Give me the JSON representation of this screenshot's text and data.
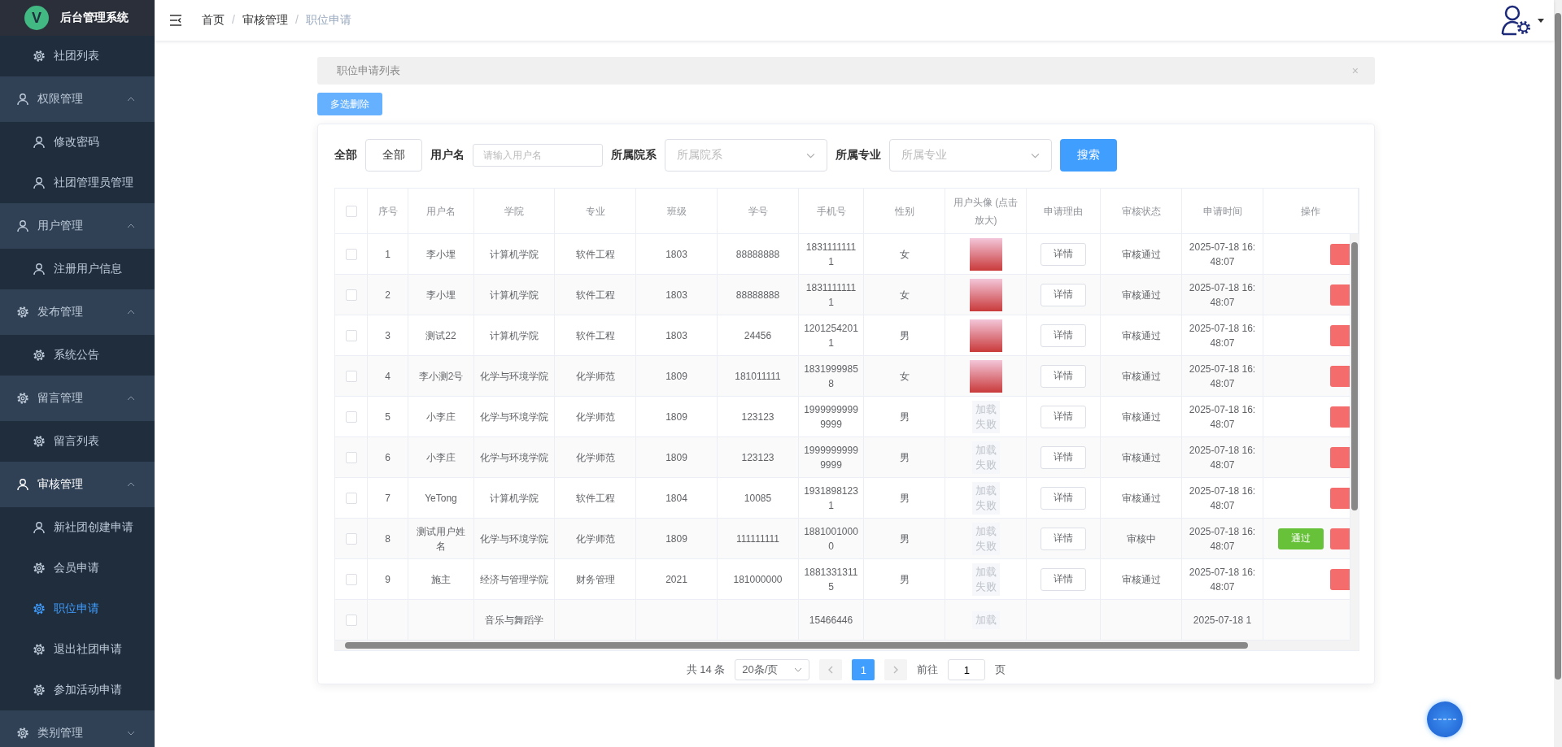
{
  "sidebar": {
    "logo": "V",
    "title": "后台管理系统",
    "items": [
      {
        "kind": "item",
        "label": "社团列表",
        "selected": false
      },
      {
        "kind": "group",
        "label": "权限管理",
        "expanded": true,
        "active": false,
        "children": [
          {
            "label": "修改密码",
            "selected": false
          },
          {
            "label": "社团管理员管理",
            "selected": false
          }
        ]
      },
      {
        "kind": "group",
        "label": "用户管理",
        "expanded": true,
        "active": false,
        "children": [
          {
            "label": "注册用户信息",
            "selected": false
          }
        ]
      },
      {
        "kind": "group",
        "label": "发布管理",
        "expanded": true,
        "active": false,
        "children": [
          {
            "label": "系统公告",
            "selected": false
          }
        ]
      },
      {
        "kind": "group",
        "label": "留言管理",
        "expanded": true,
        "active": false,
        "children": [
          {
            "label": "留言列表",
            "selected": false
          }
        ]
      },
      {
        "kind": "group",
        "label": "审核管理",
        "expanded": true,
        "active": true,
        "children": [
          {
            "label": "新社团创建申请",
            "selected": false
          },
          {
            "label": "会员申请",
            "selected": false
          },
          {
            "label": "职位申请",
            "selected": true
          },
          {
            "label": "退出社团申请",
            "selected": false
          },
          {
            "label": "参加活动申请",
            "selected": false
          }
        ]
      },
      {
        "kind": "group",
        "label": "类别管理",
        "expanded": false,
        "active": false
      }
    ]
  },
  "breadcrumb": {
    "separator": "/",
    "items": [
      "首页",
      "审核管理",
      "职位申请"
    ]
  },
  "tag": {
    "label": "职位申请列表",
    "close": "×"
  },
  "bulk_delete_button": "多选删除",
  "filters": {
    "all_label": "全部",
    "all_button": "全部",
    "username_label": "用户名",
    "username_placeholder": "请输入用户名",
    "college_label": "所属院系",
    "college_placeholder": "所属院系",
    "major_label": "所属专业",
    "major_placeholder": "所属专业",
    "search_button": "搜索"
  },
  "table": {
    "select_all_checked": false,
    "columns": [
      "序号",
      "用户名",
      "学院",
      "专业",
      "班级",
      "学号",
      "手机号",
      "性别",
      "用户头像 (点击放大)",
      "申请理由",
      "审核状态",
      "申请时间",
      "操作"
    ],
    "rows": [
      {
        "checked": false,
        "no": "1",
        "username": "李小埋",
        "college": "计算机学院",
        "major": "软件工程",
        "class": "1803",
        "student_id": "88888888",
        "phone": "18311111111",
        "gender": "女",
        "avatar": {
          "kind": "photo"
        },
        "reason": "详情",
        "status": "审核通过",
        "time": "2025-07-18 16:48:07",
        "actions": [
          {
            "kind": "delete"
          }
        ]
      },
      {
        "checked": false,
        "no": "2",
        "username": "李小埋",
        "college": "计算机学院",
        "major": "软件工程",
        "class": "1803",
        "student_id": "88888888",
        "phone": "18311111111",
        "gender": "女",
        "avatar": {
          "kind": "photo"
        },
        "reason": "详情",
        "status": "审核通过",
        "time": "2025-07-18 16:48:07",
        "actions": [
          {
            "kind": "delete"
          }
        ]
      },
      {
        "checked": false,
        "no": "3",
        "username": "测试22",
        "college": "计算机学院",
        "major": "软件工程",
        "class": "1803",
        "student_id": "24456",
        "phone": "12012542011",
        "gender": "男",
        "avatar": {
          "kind": "photo"
        },
        "reason": "详情",
        "status": "审核通过",
        "time": "2025-07-18 16:48:07",
        "actions": [
          {
            "kind": "delete"
          }
        ]
      },
      {
        "checked": false,
        "no": "4",
        "username": "李小测2号",
        "college": "化学与环境学院",
        "major": "化学师范",
        "class": "1809",
        "student_id": "181011111",
        "phone": "18319999858",
        "gender": "女",
        "avatar": {
          "kind": "photo"
        },
        "reason": "详情",
        "status": "审核通过",
        "time": "2025-07-18 16:48:07",
        "actions": [
          {
            "kind": "delete"
          }
        ]
      },
      {
        "checked": false,
        "no": "5",
        "username": "小李庄",
        "college": "化学与环境学院",
        "major": "化学师范",
        "class": "1809",
        "student_id": "123123",
        "phone": "19999999999999",
        "gender": "男",
        "avatar": {
          "kind": "failed",
          "text": "加载失败"
        },
        "reason": "详情",
        "status": "审核通过",
        "time": "2025-07-18 16:48:07",
        "actions": [
          {
            "kind": "delete"
          }
        ]
      },
      {
        "checked": false,
        "no": "6",
        "username": "小李庄",
        "college": "化学与环境学院",
        "major": "化学师范",
        "class": "1809",
        "student_id": "123123",
        "phone": "19999999999999",
        "gender": "男",
        "avatar": {
          "kind": "failed",
          "text": "加载失败"
        },
        "reason": "详情",
        "status": "审核通过",
        "time": "2025-07-18 16:48:07",
        "actions": [
          {
            "kind": "delete"
          }
        ]
      },
      {
        "checked": false,
        "no": "7",
        "username": "YeTong",
        "college": "计算机学院",
        "major": "软件工程",
        "class": "1804",
        "student_id": "10085",
        "phone": "19318981231",
        "gender": "男",
        "avatar": {
          "kind": "failed",
          "text": "加载失败"
        },
        "reason": "详情",
        "status": "审核通过",
        "time": "2025-07-18 16:48:07",
        "actions": [
          {
            "kind": "delete"
          }
        ]
      },
      {
        "checked": false,
        "no": "8",
        "username": "测试用户姓名",
        "college": "化学与环境学院",
        "major": "化学师范",
        "class": "1809",
        "student_id": "111111111",
        "phone": "18810010000",
        "gender": "男",
        "avatar": {
          "kind": "failed",
          "text": "加载失败"
        },
        "reason": "详情",
        "status": "审核中",
        "time": "2025-07-18 16:48:07",
        "actions": [
          {
            "kind": "approve",
            "label": "通过"
          },
          {
            "kind": "delete"
          }
        ]
      },
      {
        "checked": false,
        "no": "9",
        "username": "施主",
        "college": "经济与管理学院",
        "major": "财务管理",
        "class": "2021",
        "student_id": "181000000",
        "phone": "18813313115",
        "gender": "男",
        "avatar": {
          "kind": "failed",
          "text": "加载失败"
        },
        "reason": "详情",
        "status": "审核通过",
        "time": "2025-07-18 16:48:07",
        "actions": [
          {
            "kind": "delete"
          }
        ]
      },
      {
        "checked": false,
        "college": "音乐与舞蹈学",
        "phone": "15466446",
        "avatar": {
          "kind": "failed",
          "text": "加载"
        },
        "time": "2025-07-18 1",
        "actions": []
      }
    ]
  },
  "pagination": {
    "total": "共 14 条",
    "page_size": "20条/页",
    "pages": [
      {
        "label": "1",
        "selected": true
      }
    ],
    "goto_label": "前往",
    "goto_value": "1",
    "goto_suffix": "页"
  }
}
